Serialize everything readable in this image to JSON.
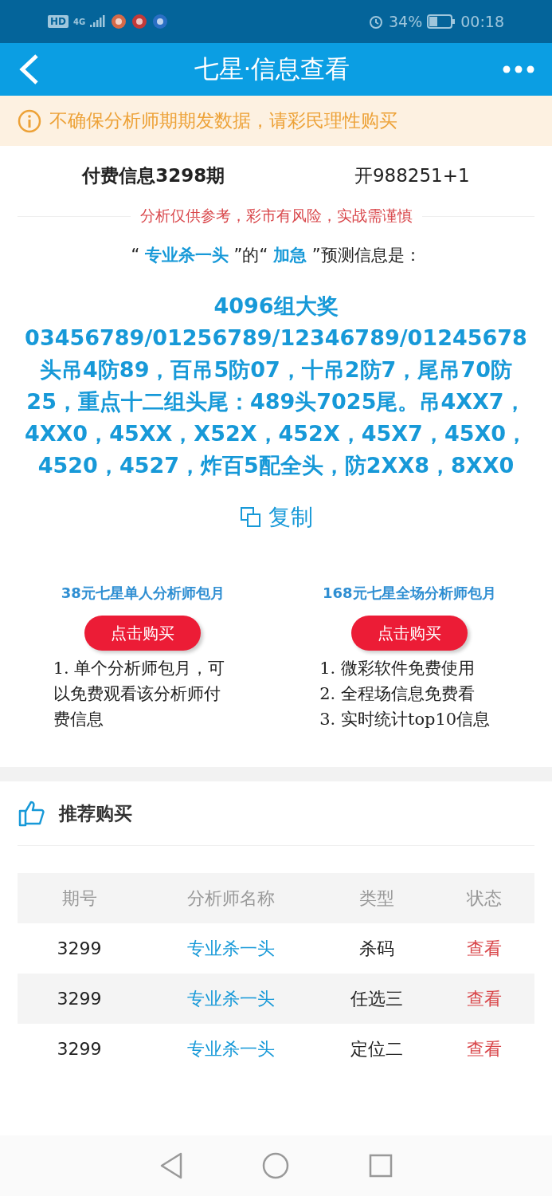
{
  "status_bar": {
    "network": [
      "HD",
      "4G"
    ],
    "battery_percent": "34%",
    "time": "00:18"
  },
  "header": {
    "title": "七星·信息查看"
  },
  "notice": {
    "text": "不确保分析师期期发数据，请彩民理性购买"
  },
  "info": {
    "issue": "付费信息3298期",
    "result": "开988251+1",
    "warning": "分析仅供参考，彩市有风险，实战需谨慎",
    "subtitle": [
      {
        "kind": "plain",
        "text": "“ "
      },
      {
        "kind": "highlight",
        "text": "专业杀一头"
      },
      {
        "kind": "plain",
        "text": " ”的“ "
      },
      {
        "kind": "highlight",
        "text": "加急"
      },
      {
        "kind": "plain",
        "text": " ”预测信息是："
      }
    ],
    "prediction": [
      "4096组大奖",
      "03456789/01256789/12346789/01245678",
      "头吊4防89，百吊5防07，十吊2防7，尾吊70防25，重点十二组头尾：489头7025尾。吊4XX7，4XX0，45XX，X52X，452X，45X7，45X0，4520，4527，炸百5配全头，防2XX8，8XX0"
    ],
    "copy_label": "复制"
  },
  "offers": [
    {
      "title": "38元七星单人分析师包月",
      "button": "点击购买",
      "lines": [
        "1. 单个分析师包月，可以免费观看该分析师付费信息"
      ]
    },
    {
      "title": "168元七星全场分析师包月",
      "button": "点击购买",
      "lines": [
        "1. 微彩软件免费使用",
        "2. 全程场信息免费看",
        "3. 实时统计top10信息"
      ]
    }
  ],
  "recommend": {
    "title": "推荐购买",
    "table": {
      "columns": [
        "期号",
        "分析师名称",
        "类型",
        "状态"
      ],
      "rows": [
        {
          "issue": "3299",
          "analyst": "专业杀一头",
          "type": "杀码",
          "status": "查看"
        },
        {
          "issue": "3299",
          "analyst": "专业杀一头",
          "type": "任选三",
          "status": "查看"
        },
        {
          "issue": "3299",
          "analyst": "专业杀一头",
          "type": "定位二",
          "status": "查看"
        }
      ]
    }
  }
}
